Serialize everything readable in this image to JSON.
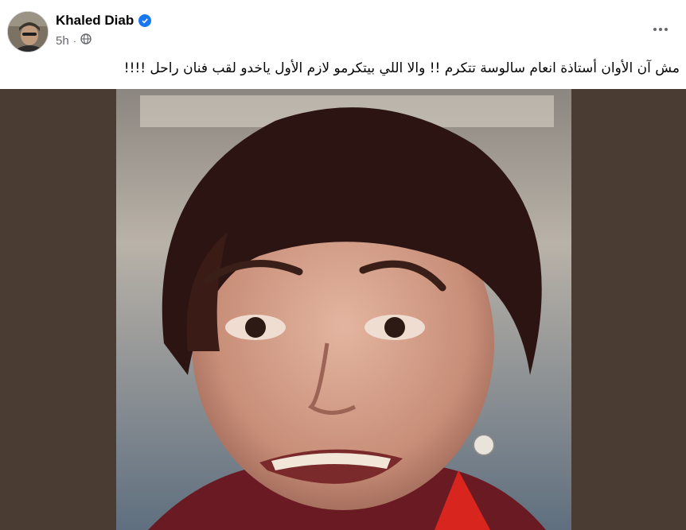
{
  "post": {
    "author_name": "Khaled Diab",
    "time": "5h",
    "visibility_icon": "globe-icon",
    "verified_icon": "verified-badge-icon",
    "more_icon": "more-options-icon",
    "text": "مش آن الأوان أستاذة انعام سالوسة تتكرم !! والا اللي بيتكرمو لازم الأول ياخدو لقب فنان راحل !!!!"
  },
  "colors": {
    "background": "#ffffff",
    "media_background": "#4a3c33",
    "accent_verified": "#1877f2",
    "secondary_text": "#65676b"
  }
}
